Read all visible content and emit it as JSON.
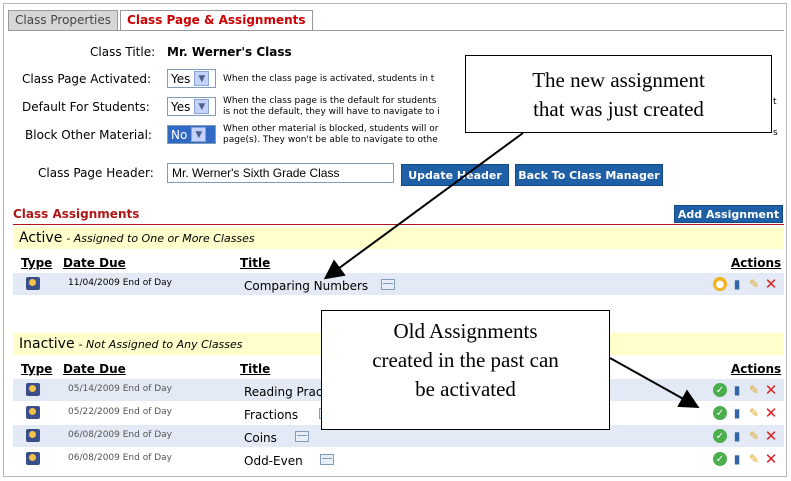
{
  "tabs": [
    "Class Properties",
    "Class Page & Assignments"
  ],
  "props": {
    "class_title_label": "Class Title:",
    "class_title_value": "Mr. Werner's Class",
    "activated_label": "Class Page Activated:",
    "activated_value": "Yes",
    "activated_note": "When the class page is activated, students in t",
    "default_label": "Default For Students:",
    "default_value": "Yes",
    "default_note_1": "When the class page is the default for students",
    "default_note_2": "is not the default, they will have to navigate to i",
    "default_note_tail": "t",
    "block_label": "Block Other Material:",
    "block_value": "No",
    "block_note_1": "When other material is blocked, students will or",
    "block_note_2": "page(s). They won't be able to navigate to othe",
    "block_note_tail": "s",
    "header_label": "Class Page Header:",
    "header_value": "Mr. Werner's Sixth Grade Class",
    "update_button": "Update Header",
    "back_button": "Back To Class Manager"
  },
  "assignments": {
    "section_title": "Class Assignments",
    "add_button": "Add Assignment",
    "active_heading": "Active",
    "active_sub": "- Assigned to One or More Classes",
    "inactive_heading": "Inactive",
    "inactive_sub": "- Not Assigned to Any Classes",
    "col_type": "Type",
    "col_date": "Date Due",
    "col_title": "Title",
    "col_actions": "Actions",
    "active_rows": [
      {
        "date": "11/04/2009 End of Day",
        "title": "Comparing Numbers"
      }
    ],
    "inactive_rows": [
      {
        "date": "05/14/2009 End of Day",
        "title": "Reading Prac"
      },
      {
        "date": "05/22/2009 End of Day",
        "title": "Fractions"
      },
      {
        "date": "06/08/2009 End of Day",
        "title": "Coins"
      },
      {
        "date": "06/08/2009 End of Day",
        "title": "Odd-Even"
      }
    ]
  },
  "callouts": {
    "new_assignment_1": "The new assignment",
    "new_assignment_2": "that was just created",
    "old_1": "Old Assignments",
    "old_2": "created in the past can",
    "old_3": "be activated"
  },
  "icons": [
    "student-type-icon",
    "calendar-icon",
    "activate-check-icon",
    "pending-icon",
    "report-bars-icon",
    "edit-pencil-icon",
    "delete-x-icon"
  ],
  "colors": {
    "accent_red": "#b01717",
    "button_blue": "#1f5fa6",
    "band_yellow": "#ffffcc",
    "row_alt": "#e3eaf5"
  }
}
